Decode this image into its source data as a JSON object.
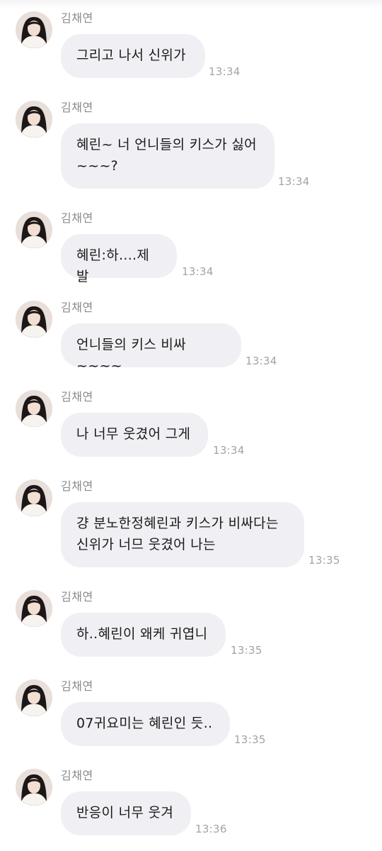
{
  "chat": {
    "messages": [
      {
        "sender": "김채연",
        "text": "그리고 나서 신위가",
        "time": "13:34"
      },
      {
        "sender": "김채연",
        "text": "혜린~ 너 언니들의 키스가 싫어\n~~~?",
        "time": "13:34"
      },
      {
        "sender": "김채연",
        "text": "혜린:하....제발",
        "time": "13:34"
      },
      {
        "sender": "김채연",
        "text": "언니들의 키스 비싸~~~~",
        "time": "13:34"
      },
      {
        "sender": "김채연",
        "text": "나 너무 웃겼어 그게",
        "time": "13:34"
      },
      {
        "sender": "김채연",
        "text": "걍 분노한정혜린과 키스가 비싸다는\n신위가 너므 웃겼어 나는",
        "time": "13:35"
      },
      {
        "sender": "김채연",
        "text": "하..혜린이 왜케 귀엽니",
        "time": "13:35"
      },
      {
        "sender": "김채연",
        "text": "07귀요미는 혜린인 듯..",
        "time": "13:35"
      },
      {
        "sender": "김채연",
        "text": "반응이 너무 웃겨",
        "time": "13:36"
      }
    ]
  },
  "colors": {
    "bubble": "#f0f0f4",
    "sender": "#8a8a8e",
    "timestamp": "#a3a3a8",
    "text": "#1a1a1a"
  }
}
